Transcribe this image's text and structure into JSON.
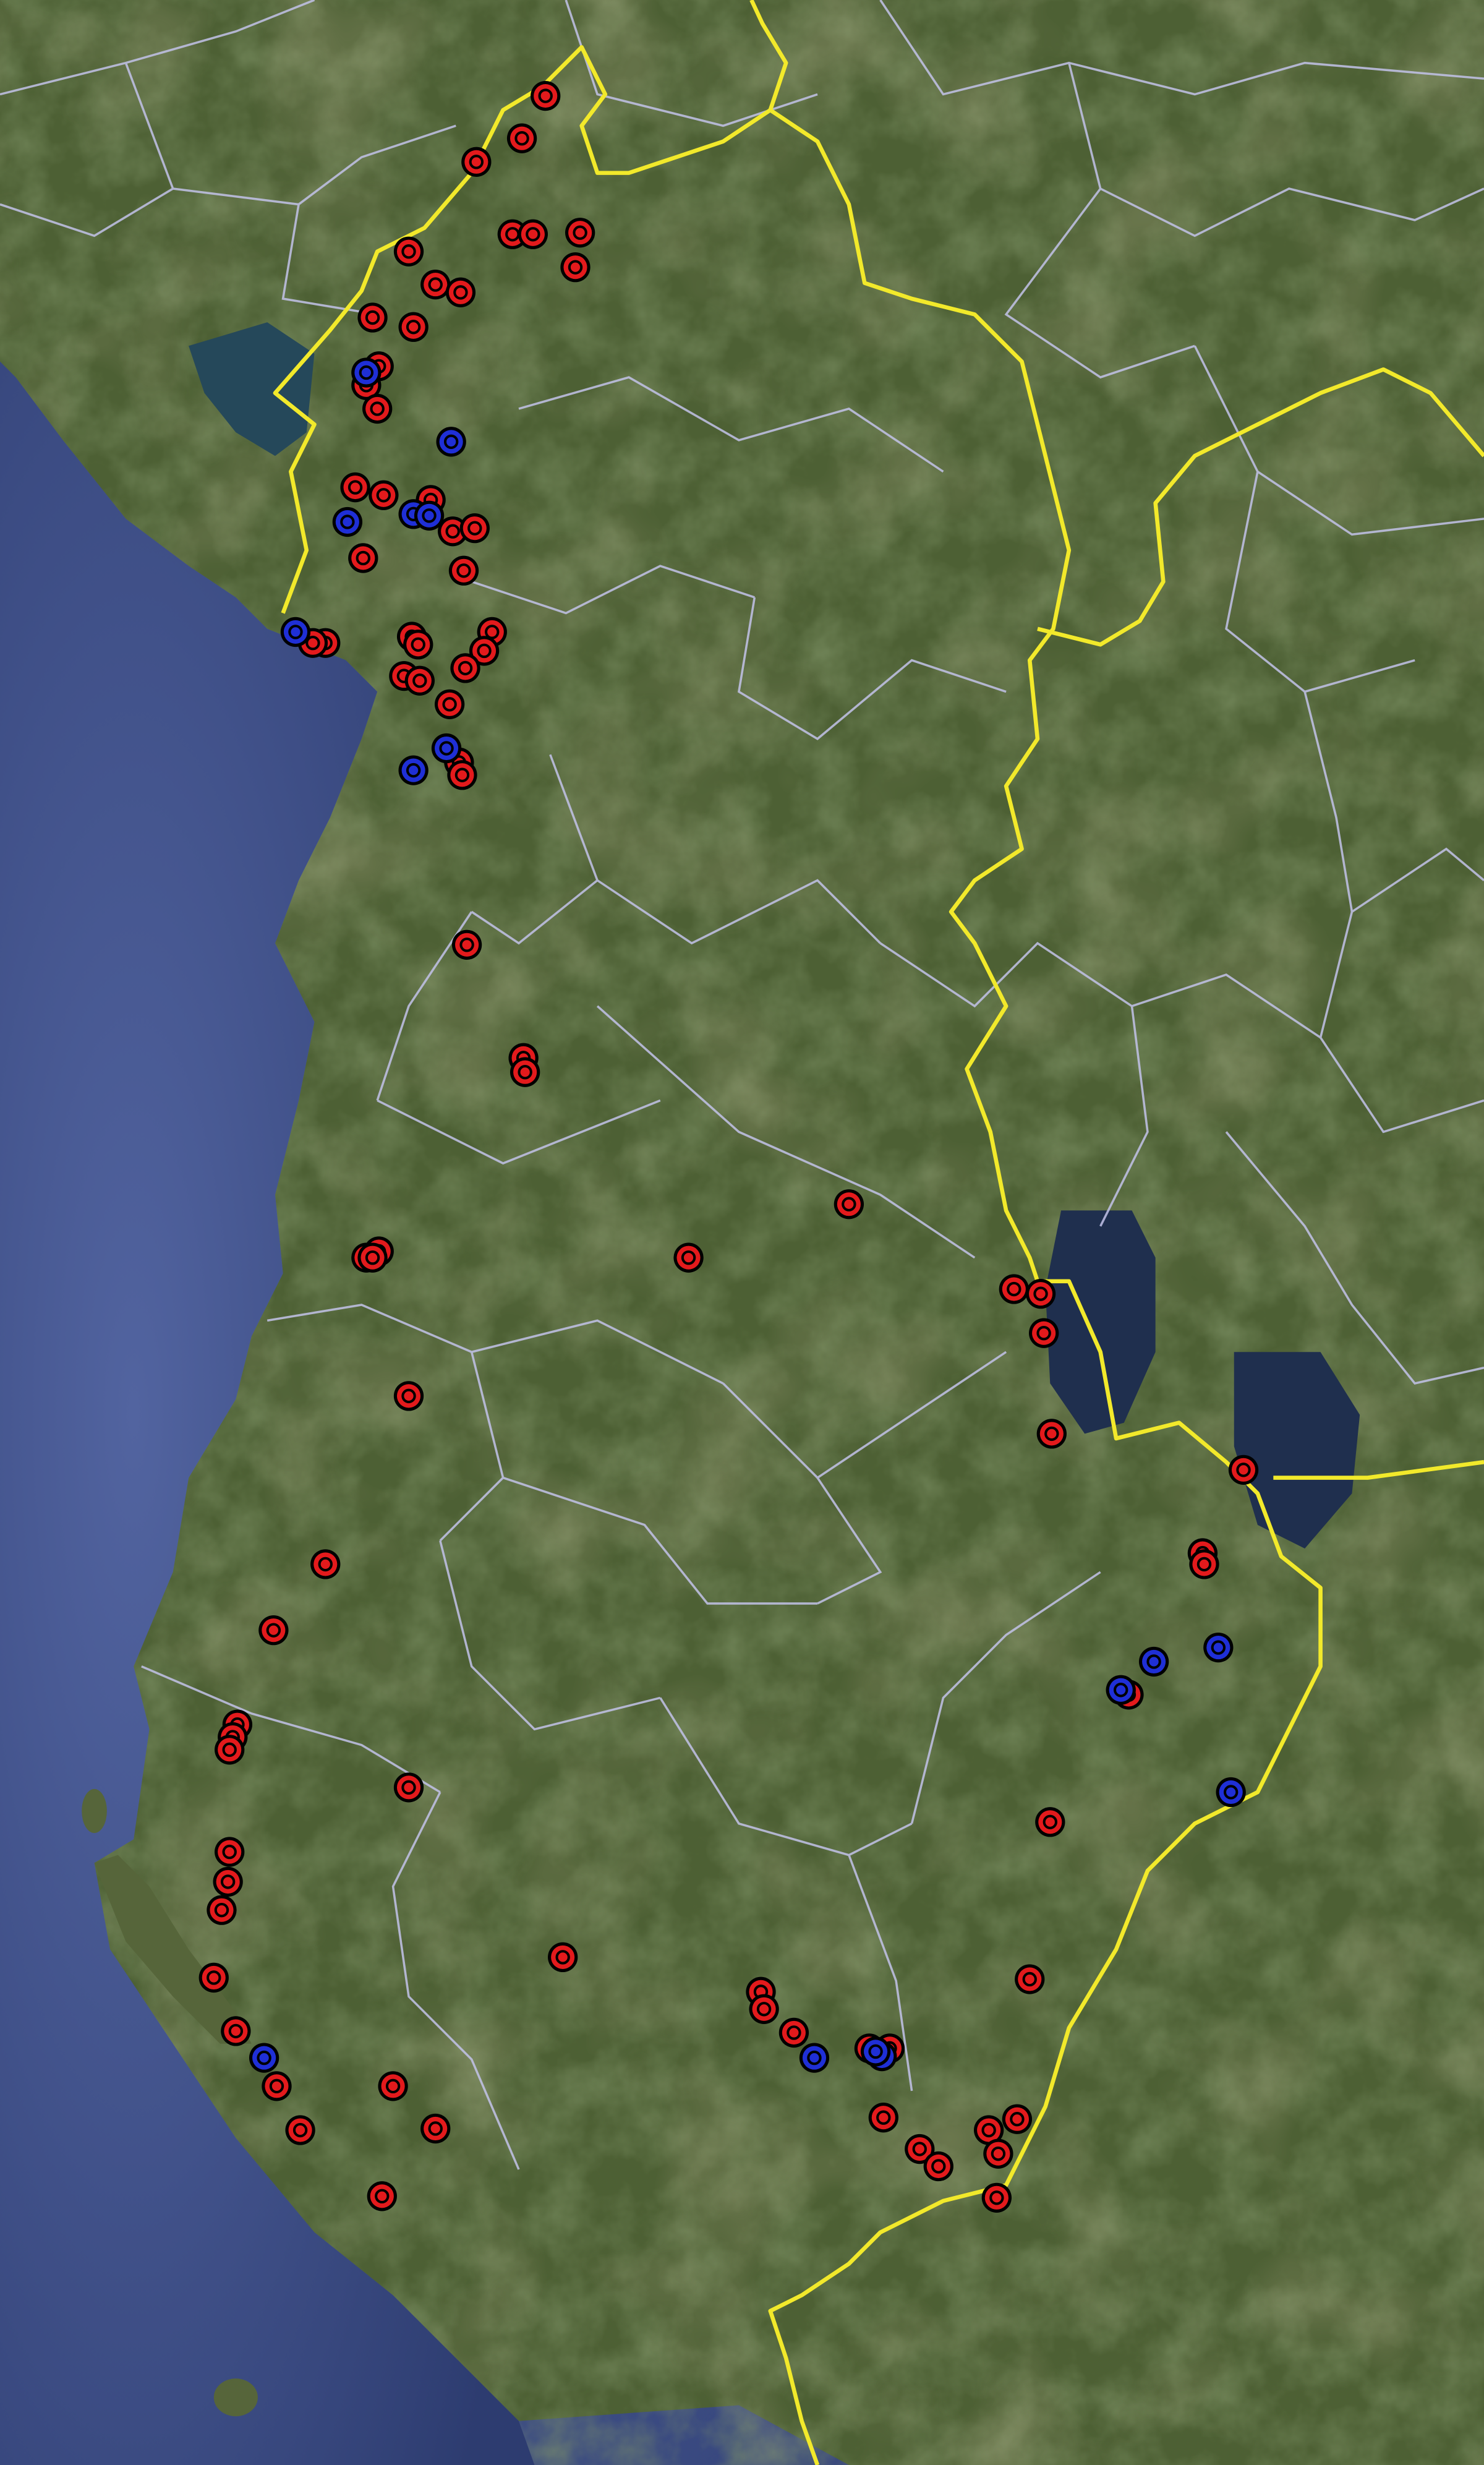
{
  "map": {
    "type": "satellite",
    "region": "Albania",
    "colors": {
      "sea": "#3d4f86",
      "land": "#4f6235",
      "national_border": "#f2e92b",
      "district_border": "#c3c3ea",
      "marker_red": "#e31a1c",
      "marker_blue": "#1f2fd6",
      "marker_ring": "#000000"
    },
    "legend": null,
    "marker_groups": [
      {
        "color_key": "marker_red",
        "count": 104
      },
      {
        "color_key": "marker_blue",
        "count": 18
      }
    ]
  }
}
